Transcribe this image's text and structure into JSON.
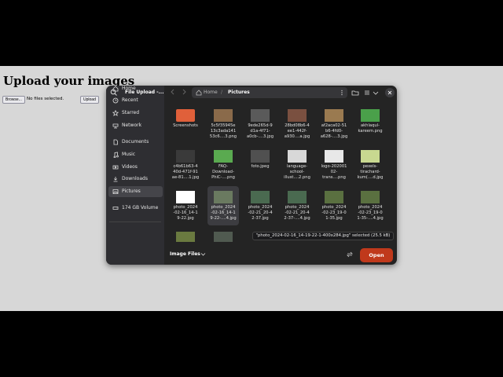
{
  "page": {
    "heading": "Upload your images",
    "browse_label": "Browse...",
    "no_file_text": "No files selected.",
    "upload_label": "Upload"
  },
  "dialog": {
    "title": "File Upload -...",
    "sidebar": [
      {
        "label": "Home",
        "icon": "home-icon"
      },
      {
        "label": "Recent",
        "icon": "clock-icon"
      },
      {
        "label": "Starred",
        "icon": "star-icon"
      },
      {
        "label": "Network",
        "icon": "network-icon"
      },
      {
        "label": "Documents",
        "icon": "document-icon"
      },
      {
        "label": "Music",
        "icon": "music-icon"
      },
      {
        "label": "Videos",
        "icon": "video-icon"
      },
      {
        "label": "Downloads",
        "icon": "download-icon"
      },
      {
        "label": "Pictures",
        "icon": "image-icon",
        "active": true
      },
      {
        "label": "174 GB Volume",
        "icon": "drive-icon"
      }
    ],
    "path": {
      "home": "Home",
      "separator": "/",
      "current": "Pictures"
    },
    "files": [
      {
        "name": "Screenshots",
        "kind": "folder"
      },
      {
        "name": "5c5f35945e\n13c3ada141\n53c6....3.png",
        "kind": "image",
        "color": "#8a6a4a"
      },
      {
        "name": "9ede265d-9\nd1a-4f71-\na0cb-....3.jpg",
        "kind": "image",
        "color": "#5a5a5a"
      },
      {
        "name": "28bd08b6-4\nee1-442f-\na930....a.jpg",
        "kind": "image",
        "color": "#7a5040"
      },
      {
        "name": "af2aca02-51\nb6-4fd0-\na628-....3.jpg",
        "kind": "image",
        "color": "#9a7a50"
      },
      {
        "name": "akhlaqul-\nkareem.png",
        "kind": "image",
        "color": "#4aa04a"
      },
      {
        "name": "c4b61b63-4\n40d-471f-91\nae-81....1.jpg",
        "kind": "image",
        "color": "#3a3a3a"
      },
      {
        "name": "FAQ-\nDownload-\nPhiC-....png",
        "kind": "image",
        "color": "#5aaa50"
      },
      {
        "name": "foto.jpeg",
        "kind": "image",
        "color": "#505050"
      },
      {
        "name": "language-\nschool-\nillust....2.png",
        "kind": "image",
        "color": "#d8d8d8"
      },
      {
        "name": "logo-202001\n02-\ntrans....png",
        "kind": "image",
        "color": "#e8e8e8"
      },
      {
        "name": "pexels-\ntirachard-\nkum(....d.jpg",
        "kind": "image",
        "color": "#c8d890"
      },
      {
        "name": "photo_2024\n-02-16_14-1\n9-22.jpg",
        "kind": "image",
        "color": "#ffffff"
      },
      {
        "name": "photo_2024\n-02-16_14-1\n9-22-....4.jpg",
        "kind": "image",
        "color": "#6a7a60",
        "selected": true
      },
      {
        "name": "photo_2024\n-02-21_20-4\n2-37.jpg",
        "kind": "image",
        "color": "#4a6a50"
      },
      {
        "name": "photo_2024\n-02-21_20-4\n2-37-....4.jpg",
        "kind": "image",
        "color": "#4a6a50"
      },
      {
        "name": "photo_2024\n-02-23_19-0\n1-35.jpg",
        "kind": "image",
        "color": "#5a7040"
      },
      {
        "name": "photo_2024\n-02-23_19-0\n1-35-....4.jpg",
        "kind": "image",
        "color": "#5a7040"
      },
      {
        "name": "",
        "kind": "image",
        "color": "#6a7a40"
      },
      {
        "name": "",
        "kind": "image",
        "color": "#505a50"
      }
    ],
    "status": "\"photo_2024-02-16_14-19-22-1-400x284.jpg\" selected (25.5 kB)",
    "filter_label": "Image Files",
    "open_label": "Open"
  }
}
